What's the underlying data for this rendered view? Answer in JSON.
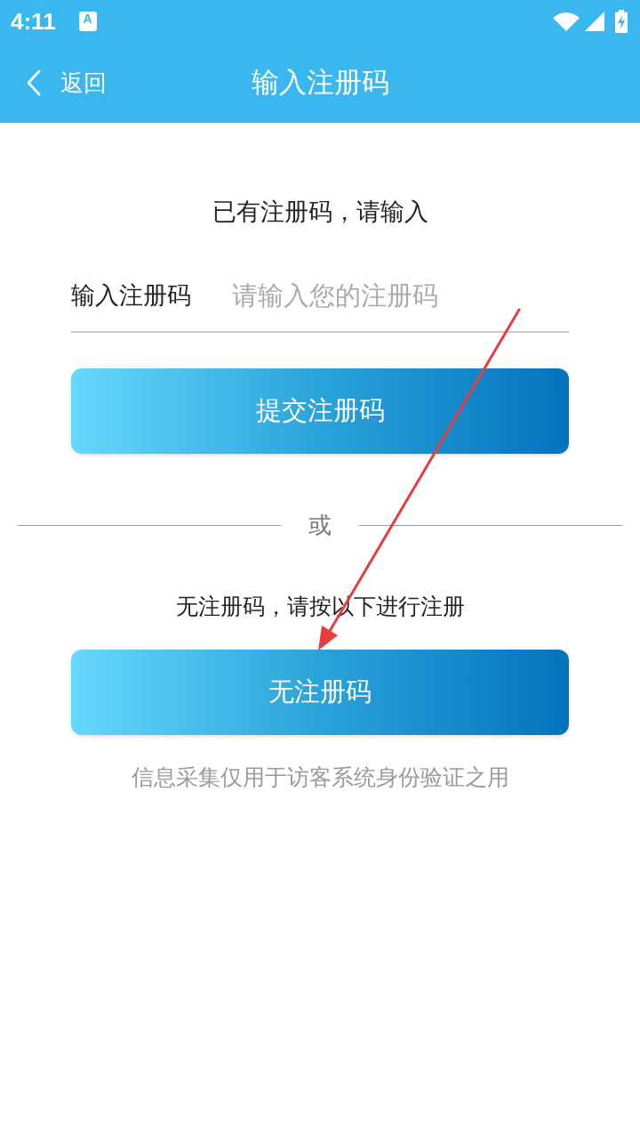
{
  "status_bar": {
    "time": "4:11",
    "app_icon_letter": "A"
  },
  "header": {
    "back_label": "返回",
    "title": "输入注册码"
  },
  "existing_code": {
    "prompt": "已有注册码，请输入",
    "field_label": "输入注册码",
    "placeholder": "请输入您的注册码",
    "submit_button": "提交注册码"
  },
  "separator": "或",
  "no_code": {
    "prompt": "无注册码，请按以下进行注册",
    "button": "无注册码"
  },
  "footnote": "信息采集仅用于访客系统身份验证之用"
}
